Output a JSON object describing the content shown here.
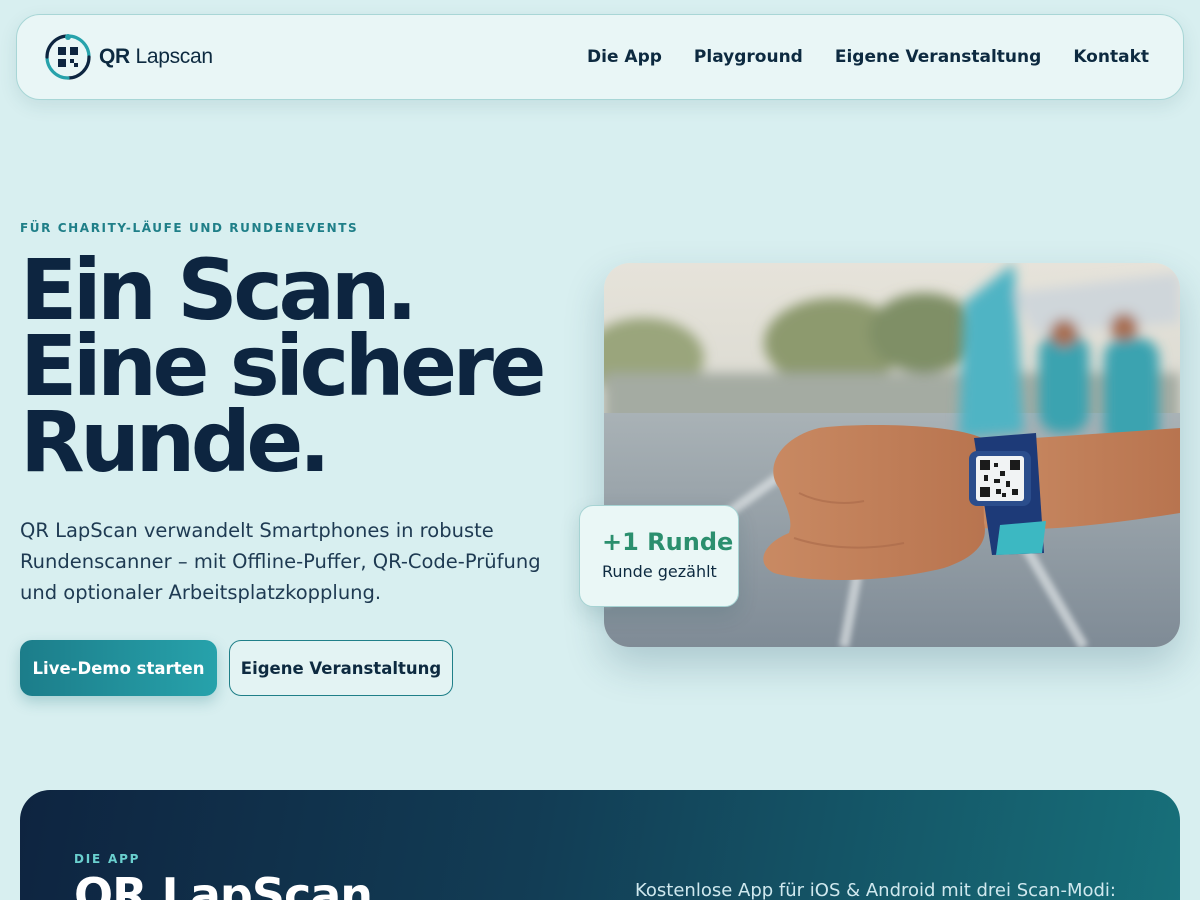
{
  "nav": {
    "logo_bold": "QR",
    "logo_light": " Lapscan",
    "links": [
      "Die App",
      "Playground",
      "Eigene Veranstaltung",
      "Kontakt"
    ]
  },
  "hero": {
    "eyebrow": "FÜR CHARITY-LÄUFE UND RUNDENEVENTS",
    "headline": [
      "Ein Scan.",
      "Eine sichere",
      "Runde."
    ],
    "lead": "QR LapScan verwandelt Smartphones in robuste Rundenscanner – mit Offline-Puffer, QR-Code-Prüfung und optionaler Arbeitsplatzkopplung.",
    "primary_button": "Live-Demo starten",
    "secondary_button": "Eigene Veranstaltung"
  },
  "badge": {
    "title": "+1 Runde",
    "subtitle": "Runde gezählt"
  },
  "app_section": {
    "eyebrow": "DIE APP",
    "title": "QR LapScan",
    "description": "Kostenlose App für iOS & Android mit drei Scan-Modi:"
  },
  "colors": {
    "background": "#d8eff0",
    "accent": "#1f7f88",
    "navy": "#0d2540",
    "badge_green": "#2b8f6e"
  }
}
